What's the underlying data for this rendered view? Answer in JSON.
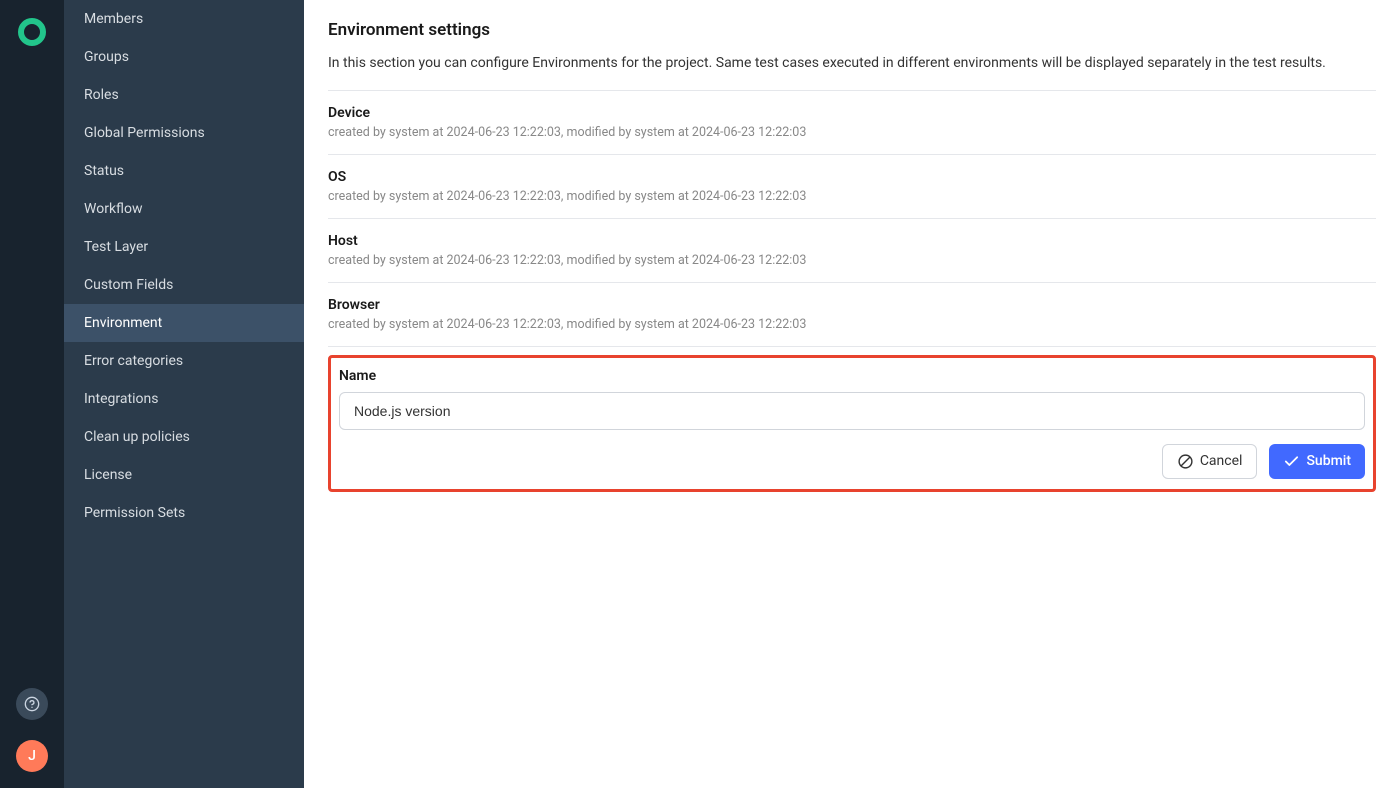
{
  "rail": {
    "avatar_initial": "J"
  },
  "sidebar": {
    "items": [
      {
        "label": "Members",
        "active": false
      },
      {
        "label": "Groups",
        "active": false
      },
      {
        "label": "Roles",
        "active": false
      },
      {
        "label": "Global Permissions",
        "active": false
      },
      {
        "label": "Status",
        "active": false
      },
      {
        "label": "Workflow",
        "active": false
      },
      {
        "label": "Test Layer",
        "active": false
      },
      {
        "label": "Custom Fields",
        "active": false
      },
      {
        "label": "Environment",
        "active": true
      },
      {
        "label": "Error categories",
        "active": false
      },
      {
        "label": "Integrations",
        "active": false
      },
      {
        "label": "Clean up policies",
        "active": false
      },
      {
        "label": "License",
        "active": false
      },
      {
        "label": "Permission Sets",
        "active": false
      }
    ]
  },
  "main": {
    "title": "Environment settings",
    "description": "In this section you can configure Environments for the project. Same test cases executed in different environments will be displayed separately in the test results.",
    "environments": [
      {
        "name": "Device",
        "meta": "created by system at 2024-06-23 12:22:03, modified by system at 2024-06-23 12:22:03"
      },
      {
        "name": "OS",
        "meta": "created by system at 2024-06-23 12:22:03, modified by system at 2024-06-23 12:22:03"
      },
      {
        "name": "Host",
        "meta": "created by system at 2024-06-23 12:22:03, modified by system at 2024-06-23 12:22:03"
      },
      {
        "name": "Browser",
        "meta": "created by system at 2024-06-23 12:22:03, modified by system at 2024-06-23 12:22:03"
      }
    ],
    "form": {
      "label": "Name",
      "value": "Node.js version",
      "cancel": "Cancel",
      "submit": "Submit"
    }
  }
}
